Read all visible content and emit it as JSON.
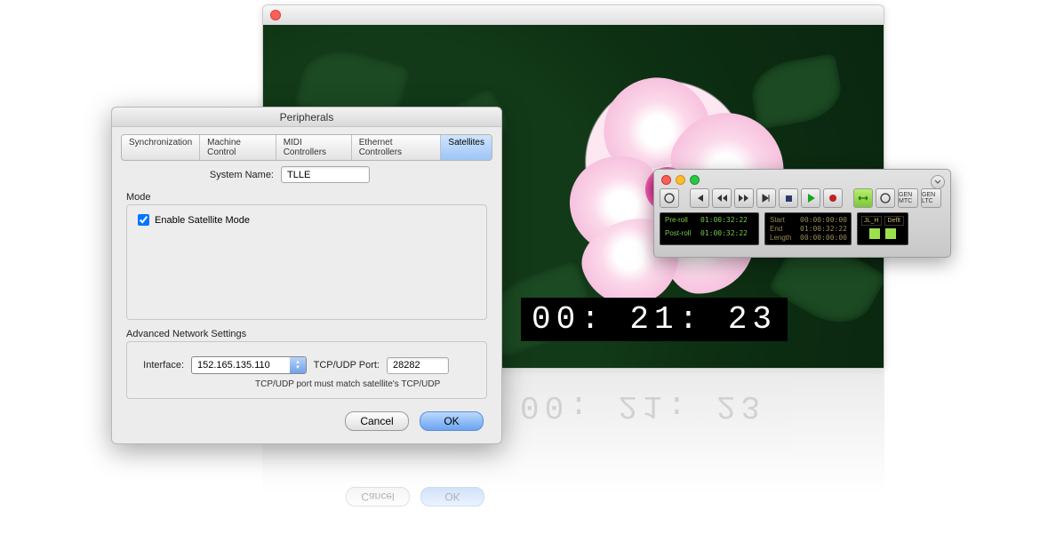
{
  "video": {
    "timecode": "00: 21: 23"
  },
  "dialog": {
    "title": "Peripherals",
    "tabs": [
      "Synchronization",
      "Machine Control",
      "MIDI Controllers",
      "Ethernet Controllers",
      "Satellites"
    ],
    "system_name_label": "System Name:",
    "system_name_value": "TLLE",
    "mode_label": "Mode",
    "enable_satellite_label": "Enable Satellite Mode",
    "enable_satellite_checked": true,
    "advanced_label": "Advanced Network Settings",
    "interface_label": "Interface:",
    "interface_value": "152.165.135.110",
    "port_label": "TCP/UDP Port:",
    "port_value": "28282",
    "note": "TCP/UDP port must match satellite's TCP/UDP",
    "cancel": "Cancel",
    "ok": "OK"
  },
  "transport": {
    "gen_mtc": "GEN MTC",
    "gen_ltc": "GEN LTC",
    "preroll_label": "Pre-roll",
    "preroll_value": "01:00:32:22",
    "postroll_label": "Post-roll",
    "postroll_value": "01:00:32:22",
    "start_label": "Start",
    "start_value": "00:00:00:00",
    "end_label": "End",
    "end_value": "01:00:32:22",
    "length_label": "Length",
    "length_value": "00:00:00:00",
    "col_a": "JL_H",
    "col_b": "Deflt"
  }
}
